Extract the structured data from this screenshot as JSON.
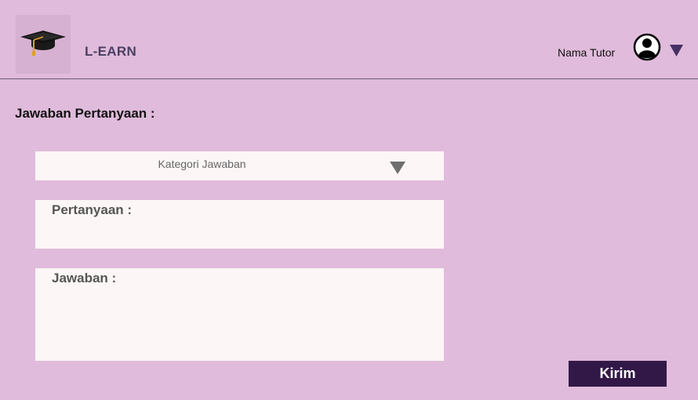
{
  "header": {
    "app_title": "L-EARN",
    "user_name": "Nama Tutor",
    "logo_icon": "graduation-cap-icon",
    "avatar_icon": "user-circle-icon",
    "menu_icon": "caret-down-icon"
  },
  "form": {
    "title": "Jawaban Pertanyaan :",
    "category_select": {
      "selected_text": "Kategori Jawaban",
      "icon": "caret-down-icon"
    },
    "question_label": "Pertanyaan :",
    "answer_label": "Jawaban :",
    "submit_label": "Kirim"
  },
  "colors": {
    "background": "#e0bbdb",
    "field_background": "#fcf6f6",
    "button": "#311847",
    "brand_text": "#4a3f63",
    "caret": "#473066"
  }
}
